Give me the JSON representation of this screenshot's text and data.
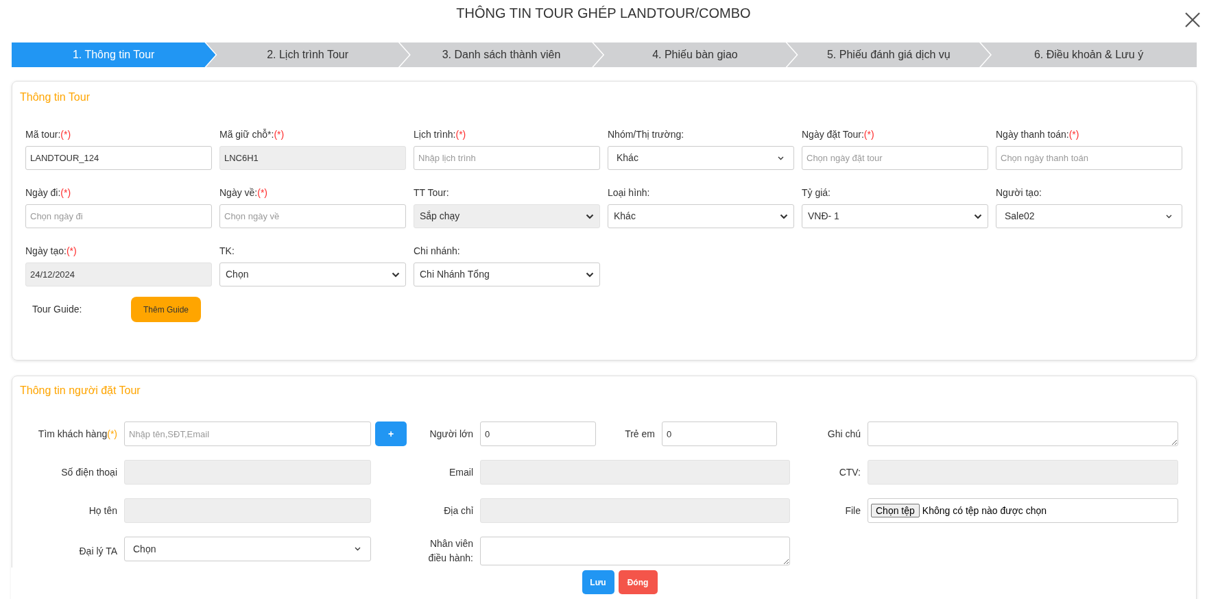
{
  "title": "THÔNG TIN TOUR GHÉP LANDTOUR/COMBO",
  "steps": [
    {
      "label": "1. Thông tin Tour",
      "selected": true
    },
    {
      "label": "2. Lịch trình Tour",
      "selected": false
    },
    {
      "label": "3. Danh sách thành viên",
      "selected": false
    },
    {
      "label": "4. Phiếu bàn giao",
      "selected": false
    },
    {
      "label": "5. Phiếu đánh giá dịch vụ",
      "selected": false
    },
    {
      "label": "6. Điều khoản & Lưu ý",
      "selected": false
    }
  ],
  "tour_info": {
    "heading": "Thông tin Tour",
    "fields": [
      {
        "label": "Mã tour:",
        "required_mark": "(*)",
        "kind": "text",
        "value": "LANDTOUR_124",
        "disabled": false
      },
      {
        "label": "Mã giữ chỗ*:",
        "required_mark": "(*)",
        "kind": "text",
        "value": "LNC6H1",
        "disabled": true
      },
      {
        "label": "Lịch trình:",
        "required_mark": "(*)",
        "kind": "text",
        "placeholder": "Nhập lịch trình",
        "disabled": false
      },
      {
        "label": "Nhóm/Thị trường:",
        "kind": "dropdown",
        "value": "Khác",
        "disabled": false
      },
      {
        "label": "Ngày đặt Tour:",
        "required_mark": "(*)",
        "kind": "text",
        "placeholder": "Chọn ngày đặt tour",
        "disabled": false
      },
      {
        "label": "Ngày thanh toán:",
        "required_mark": "(*)",
        "kind": "text",
        "placeholder": "Chọn ngày thanh toán",
        "disabled": false
      },
      {
        "label": "Ngày đi:",
        "required_mark": "(*)",
        "kind": "text",
        "placeholder": "Chọn ngày đi",
        "disabled": false
      },
      {
        "label": "Ngày về:",
        "required_mark": "(*)",
        "kind": "text",
        "placeholder": "Chọn ngày về",
        "disabled": false
      },
      {
        "label": "TT Tour:",
        "kind": "select",
        "value": "Sắp chạy",
        "disabled": true
      },
      {
        "label": "Loại hình:",
        "kind": "select",
        "value": "Khác",
        "disabled": false
      },
      {
        "label": "Tỷ giá:",
        "kind": "select",
        "value": "VNĐ- 1",
        "disabled": false
      },
      {
        "label": "Người tạo:",
        "kind": "dropdown",
        "value": "Sale02",
        "disabled": false
      },
      {
        "label": "Ngày tạo:",
        "required_mark": "(*)",
        "kind": "text",
        "value": "24/12/2024",
        "disabled": true
      },
      {
        "label": "TK:",
        "kind": "select",
        "value": "Chọn",
        "disabled": false
      },
      {
        "label": "Chi nhánh:",
        "kind": "select",
        "value": "Chi Nhánh Tổng",
        "disabled": false
      }
    ],
    "guide": {
      "label": "Tour Guide:",
      "button": "Thêm Guide"
    }
  },
  "booker": {
    "heading": "Thông tin người đặt Tour",
    "rows": [
      {
        "left": {
          "label": "Tìm khách hàng",
          "required_mark": "(*)",
          "kind": "search",
          "placeholder": "Nhập tên,SĐT,Email",
          "button": "+",
          "disabled": false
        },
        "middle": [
          {
            "label": "Người lớn",
            "kind": "text",
            "value": "0",
            "disabled": false
          },
          {
            "label": "Trẻ em",
            "kind": "text",
            "value": "0",
            "disabled": false
          }
        ],
        "right": {
          "label": "Ghi chú",
          "kind": "textarea"
        }
      },
      {
        "left": {
          "label": "Số điện thoại",
          "kind": "text",
          "disabled": true
        },
        "middle": [
          {
            "label": "Email",
            "kind": "text",
            "disabled": true
          }
        ],
        "right": {
          "label": "CTV:",
          "kind": "text",
          "disabled": true
        }
      },
      {
        "left": {
          "label": "Họ tên",
          "kind": "text",
          "disabled": true
        },
        "middle": [
          {
            "label": "Địa chỉ",
            "kind": "text",
            "disabled": true
          }
        ],
        "right": {
          "label": "File",
          "kind": "file",
          "button": "Chọn tệp",
          "value": "Không có tệp nào được chọn"
        }
      },
      {
        "left": {
          "label": "Đại lý TA",
          "kind": "dropdown",
          "value": "Chọn",
          "disabled": false
        },
        "middle": [
          {
            "label": "Nhân viên điều hành:",
            "kind": "textarea"
          }
        ]
      }
    ]
  },
  "footer": {
    "buttons": [
      {
        "label": "Lưu",
        "kind": "primary"
      },
      {
        "label": "Đóng",
        "kind": "danger"
      }
    ]
  }
}
